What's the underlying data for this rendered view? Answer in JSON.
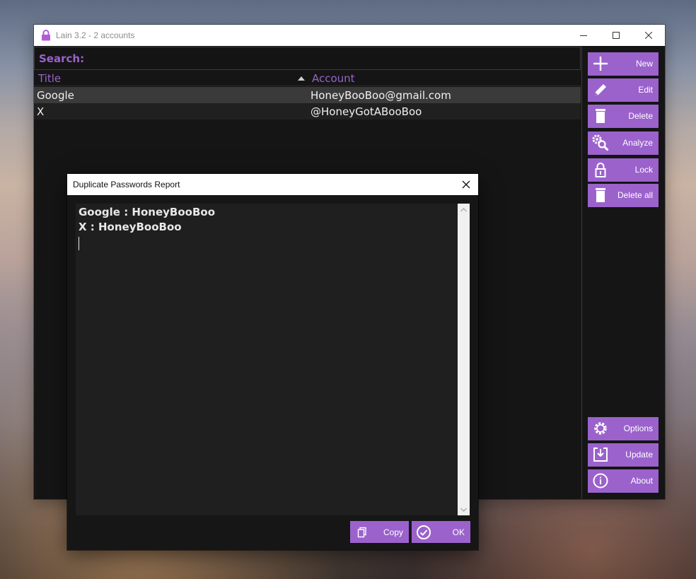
{
  "window": {
    "title": "Lain 3.2 - 2 accounts"
  },
  "search": {
    "label": "Search:",
    "value": "",
    "placeholder": ""
  },
  "list": {
    "headers": {
      "title": "Title",
      "account": "Account"
    },
    "rows": [
      {
        "title": "Google",
        "account": "HoneyBooBoo@gmail.com"
      },
      {
        "title": "X",
        "account": "@HoneyGotABooBoo"
      }
    ]
  },
  "sidebar": {
    "top_buttons": [
      {
        "label": "New",
        "icon": "plus-icon"
      },
      {
        "label": "Edit",
        "icon": "pencil-icon"
      },
      {
        "label": "Delete",
        "icon": "trash-icon"
      },
      {
        "label": "Analyze",
        "icon": "gears-search-icon"
      },
      {
        "label": "Lock",
        "icon": "lock-icon"
      },
      {
        "label": "Delete all",
        "icon": "trash-icon"
      }
    ],
    "bottom_buttons": [
      {
        "label": "Options",
        "icon": "gear-icon"
      },
      {
        "label": "Update",
        "icon": "download-icon"
      },
      {
        "label": "About",
        "icon": "info-icon"
      }
    ]
  },
  "dialog": {
    "title": "Duplicate Passwords Report",
    "lines": [
      "Google : HoneyBooBoo",
      "X : HoneyBooBoo"
    ],
    "buttons": {
      "copy": {
        "label": "Copy",
        "icon": "copy-icon"
      },
      "ok": {
        "label": "OK",
        "icon": "check-circle-icon"
      }
    }
  },
  "colors": {
    "accent": "#9b62cc",
    "background": "#151515",
    "selected_row": "#3a3a3a",
    "text": "#f0f0f0"
  }
}
